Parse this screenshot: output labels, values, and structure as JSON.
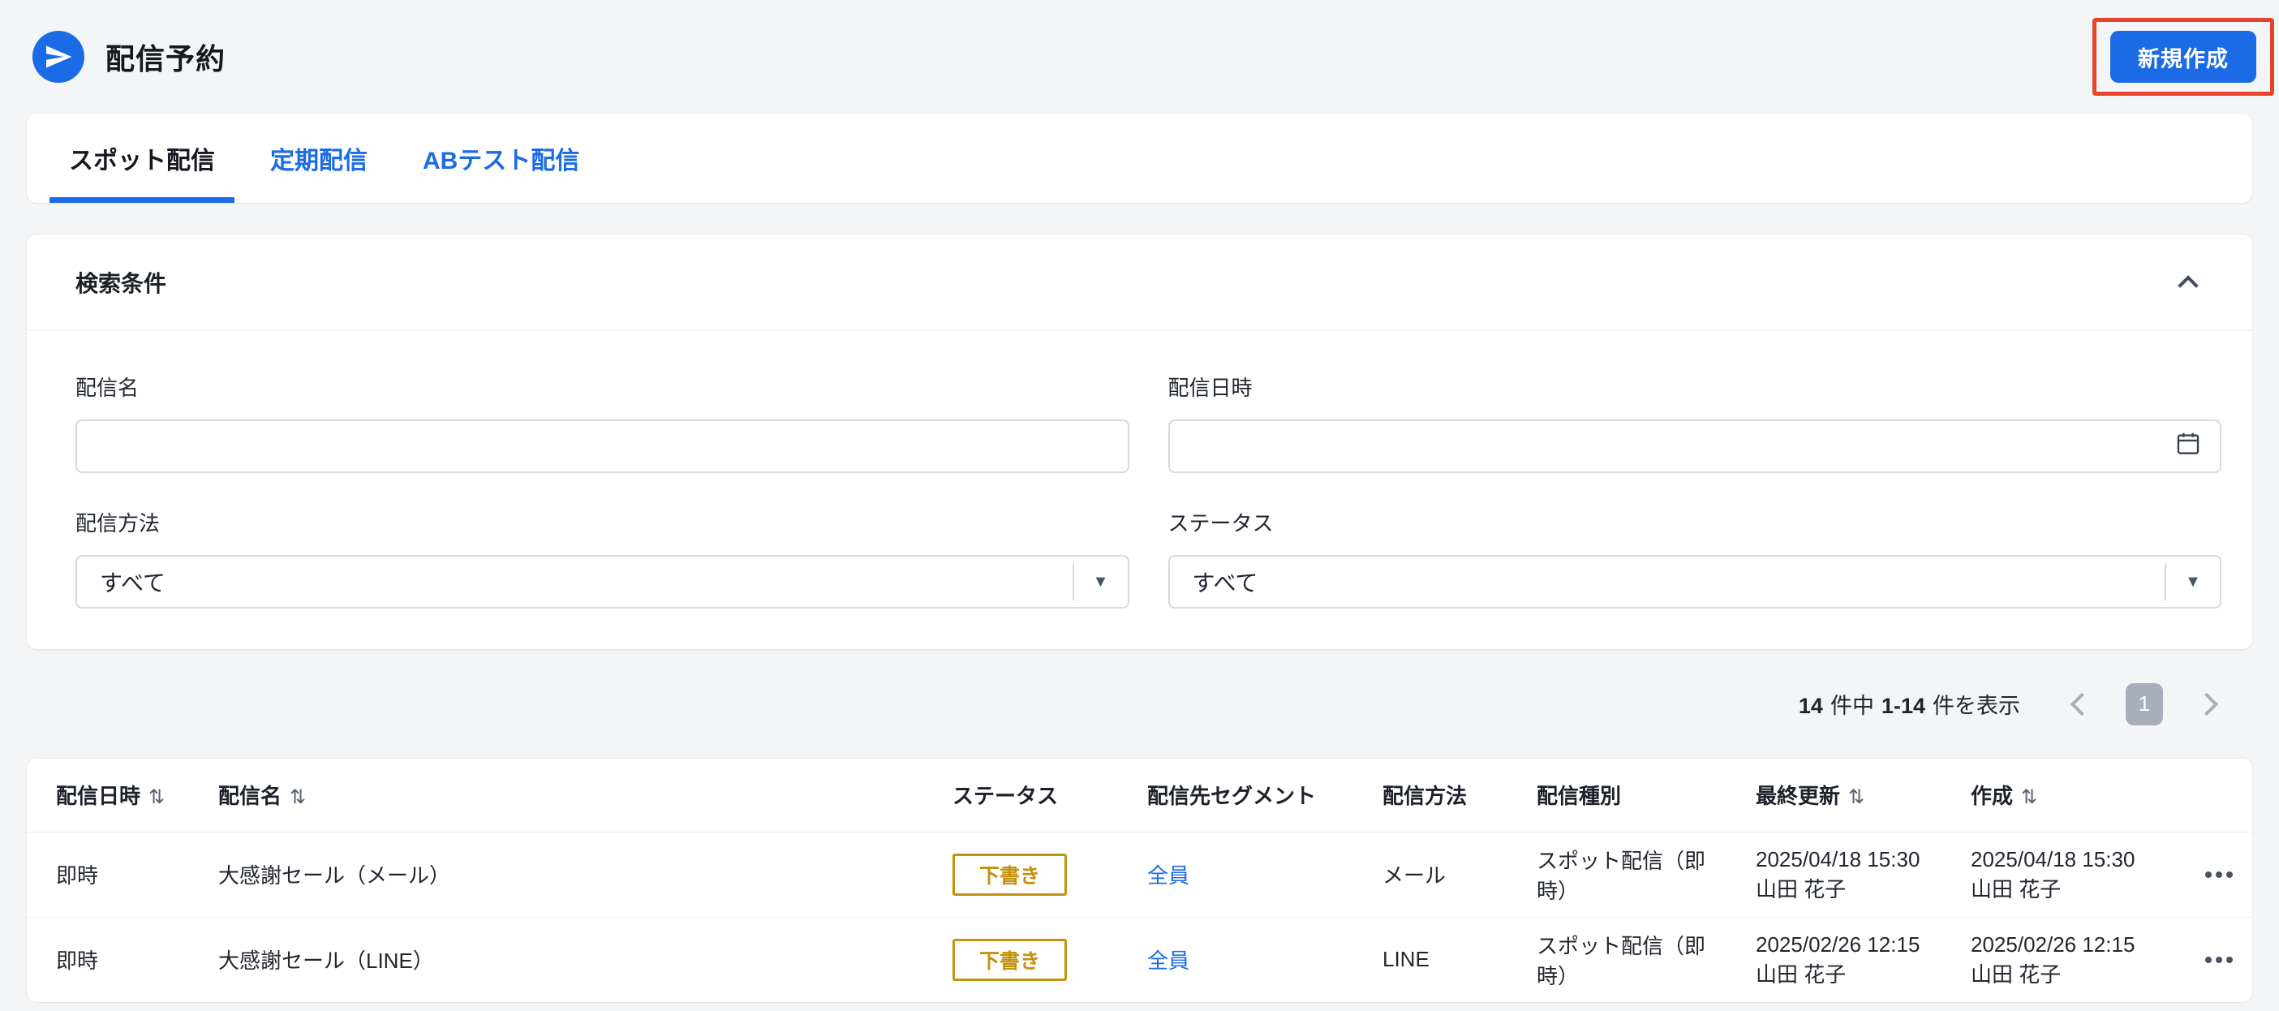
{
  "header": {
    "title": "配信予約",
    "create_button": "新規作成"
  },
  "tabs": [
    {
      "label": "スポット配信",
      "active": true
    },
    {
      "label": "定期配信",
      "active": false
    },
    {
      "label": "ABテスト配信",
      "active": false
    }
  ],
  "search": {
    "title": "検索条件",
    "name_label": "配信名",
    "name_value": "",
    "datetime_label": "配信日時",
    "datetime_value": "",
    "method_label": "配信方法",
    "method_value": "すべて",
    "status_label": "ステータス",
    "status_value": "すべて"
  },
  "pagination": {
    "total": "14",
    "of_text": "件中",
    "range": "1-14",
    "show_text": "件を表示",
    "page": "1"
  },
  "table": {
    "columns": [
      {
        "label": "配信日時",
        "sortable": true
      },
      {
        "label": "配信名",
        "sortable": true
      },
      {
        "label": "ステータス",
        "sortable": false
      },
      {
        "label": "配信先セグメント",
        "sortable": false
      },
      {
        "label": "配信方法",
        "sortable": false
      },
      {
        "label": "配信種別",
        "sortable": false
      },
      {
        "label": "最終更新",
        "sortable": true
      },
      {
        "label": "作成",
        "sortable": true
      }
    ],
    "rows": [
      {
        "datetime": "即時",
        "name": "大感謝セール（メール）",
        "status": "下書き",
        "segment": "全員",
        "method": "メール",
        "type": "スポット配信（即時）",
        "updated_at": "2025/04/18 15:30",
        "updated_by": "山田 花子",
        "created_at": "2025/04/18 15:30",
        "created_by": "山田 花子"
      },
      {
        "datetime": "即時",
        "name": "大感謝セール（LINE）",
        "status": "下書き",
        "segment": "全員",
        "method": "LINE",
        "type": "スポット配信（即時）",
        "updated_at": "2025/02/26 12:15",
        "updated_by": "山田 花子",
        "created_at": "2025/02/26 12:15",
        "created_by": "山田 花子"
      }
    ]
  },
  "icons": {
    "sort": "⇅",
    "caret": "▼"
  },
  "colors": {
    "accent": "#1a6be5",
    "badge_gold": "#c3920e",
    "annotation_red": "#e8432c"
  }
}
